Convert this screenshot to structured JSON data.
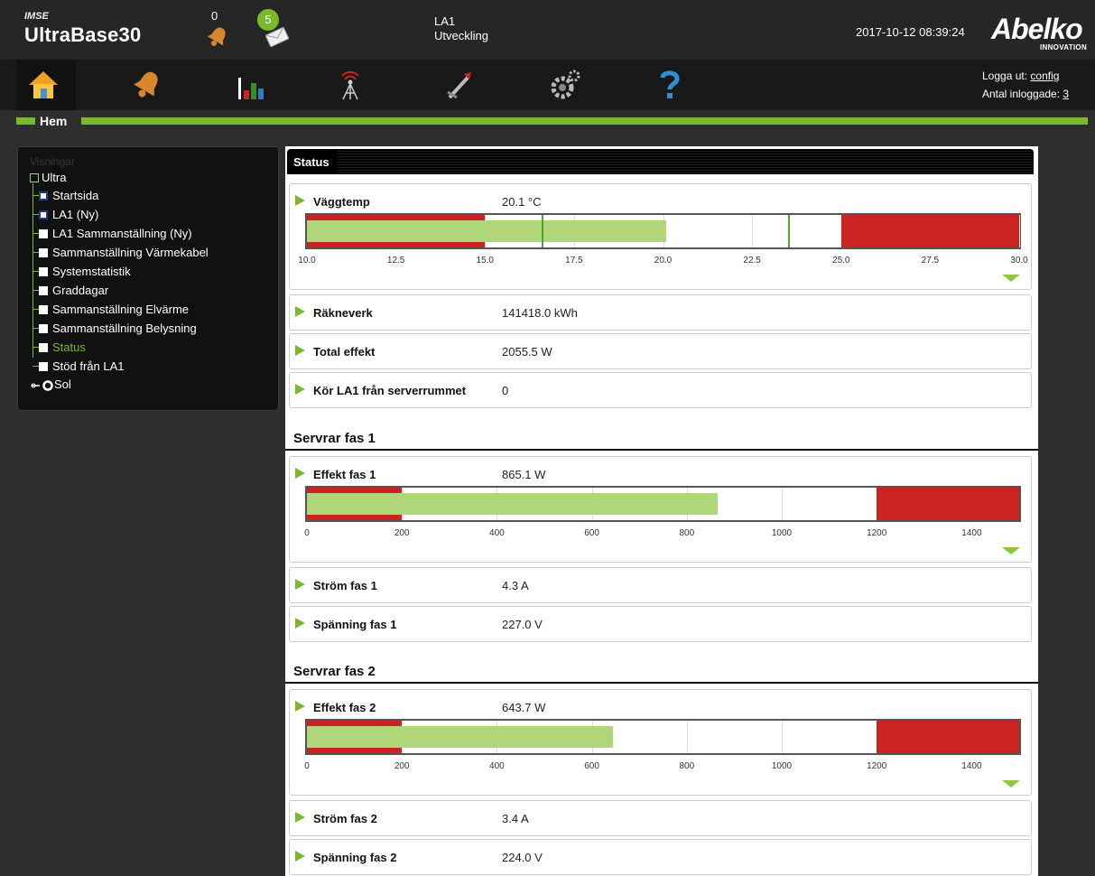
{
  "header": {
    "brand_small": "IMSE",
    "brand_main": "UltraBase30",
    "alarm_count": "0",
    "message_count": "5",
    "unit_name": "LA1",
    "unit_sub": "Utveckling",
    "datetime": "2017-10-12 08:39:24",
    "logo_word": "Abelko",
    "logo_sub": "INNOVATION"
  },
  "nav": {
    "items": [
      "home-icon",
      "alarm-bell-icon",
      "chart-icon",
      "antenna-icon",
      "tools-icon",
      "gears-icon",
      "help-icon"
    ],
    "logout_prefix": "Logga ut:",
    "logout_user": "config",
    "logged_in_prefix": "Antal inloggade:",
    "logged_in_count": "3"
  },
  "section": {
    "title": "Hem"
  },
  "tree": {
    "heading": "Visningar",
    "root": "Ultra",
    "items": [
      "Startsida",
      "LA1 (Ny)",
      "LA1 Sammanställning (Ny)",
      "Sammanställning Värmekabel",
      "Systemstatistik",
      "Graddagar",
      "Sammanställning Elvärme",
      "Sammanställning Belysning",
      "Status",
      "Stöd från LA1"
    ],
    "selected": "Status",
    "sol": "Sol"
  },
  "main": {
    "status_title": "Status",
    "cards": {
      "vaggtemp": {
        "label": "Väggtemp",
        "value": "20.1 °C"
      },
      "raknevek": {
        "label": "Räkneverk",
        "value": "141418.0 kWh"
      },
      "total": {
        "label": "Total effekt",
        "value": "2055.5 W"
      },
      "kor": {
        "label": "Kör LA1 från serverrummet",
        "value": "0"
      },
      "effekt1": {
        "label": "Effekt fas 1",
        "value": "865.1 W"
      },
      "strom1": {
        "label": "Ström fas 1",
        "value": "4.3 A"
      },
      "spanning1": {
        "label": "Spänning fas 1",
        "value": "227.0 V"
      },
      "effekt2": {
        "label": "Effekt fas 2",
        "value": "643.7 W"
      },
      "strom2": {
        "label": "Ström fas 2",
        "value": "3.4 A"
      },
      "spanning2": {
        "label": "Spänning fas 2",
        "value": "224.0 V"
      }
    },
    "groups": {
      "fas1": "Servrar fas 1",
      "fas2": "Servrar fas 2"
    },
    "gauges": {
      "temp": {
        "min": 10,
        "max": 30,
        "value": 20.1,
        "low_alarm": 15,
        "high_alarm": 25,
        "markers": [
          16.6,
          23.5
        ],
        "ticks": [
          "10.0",
          "12.5",
          "15.0",
          "17.5",
          "20.0",
          "22.5",
          "25.0",
          "27.5",
          "30.0"
        ]
      },
      "fas1": {
        "min": 0,
        "max": 1500,
        "value": 865.1,
        "low_alarm": 200,
        "high_alarm": 1200,
        "ticks": [
          "0",
          "200",
          "400",
          "600",
          "800",
          "1000",
          "1200",
          "1400"
        ]
      },
      "fas2": {
        "min": 0,
        "max": 1500,
        "value": 643.7,
        "low_alarm": 200,
        "high_alarm": 1200,
        "ticks": [
          "0",
          "200",
          "400",
          "600",
          "800",
          "1000",
          "1200",
          "1400"
        ]
      }
    }
  },
  "colors": {
    "accent": "#7ab82e",
    "alarm_red": "#cc2222",
    "fill_green": "#b0d67a"
  }
}
